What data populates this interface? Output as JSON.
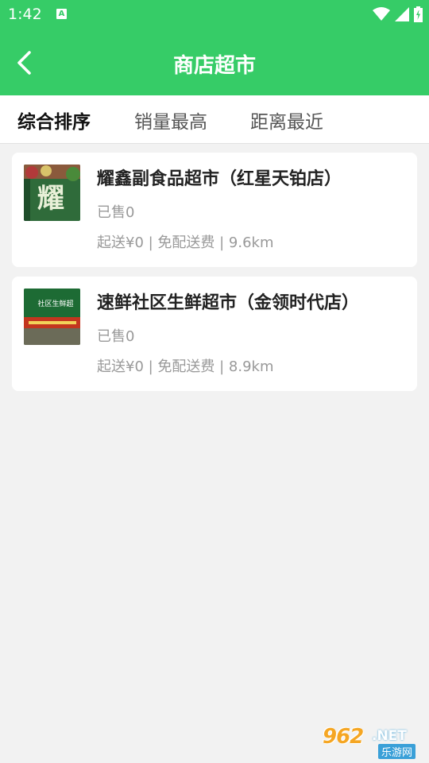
{
  "status_bar": {
    "time": "1:42",
    "notification_badge": "A",
    "icons": [
      "wifi-icon",
      "cellular-signal-icon",
      "battery-icon"
    ]
  },
  "header": {
    "title": "商店超市",
    "back_icon": "chevron-left-icon"
  },
  "tabs": [
    {
      "label": "综合排序",
      "active": true
    },
    {
      "label": "销量最高",
      "active": false
    },
    {
      "label": "距离最近",
      "active": false
    }
  ],
  "stores": [
    {
      "name": "耀鑫副食品超市（红星天铂店）",
      "sold": "已售0",
      "meta": "起送¥0 | 免配送费 | 9.6km",
      "thumb_text": "耀"
    },
    {
      "name": "速鲜社区生鲜超市（金领时代店）",
      "sold": "已售0",
      "meta": "起送¥0 | 免配送费 | 8.9km",
      "thumb_text": "社区生鲜超"
    }
  ],
  "watermark": {
    "number": "962",
    "domain": ".NET",
    "site": "乐游网"
  },
  "colors": {
    "primary": "#36cc67",
    "background": "#f2f2f2",
    "card": "#ffffff",
    "title_text": "#222222",
    "muted_text": "#999999"
  }
}
